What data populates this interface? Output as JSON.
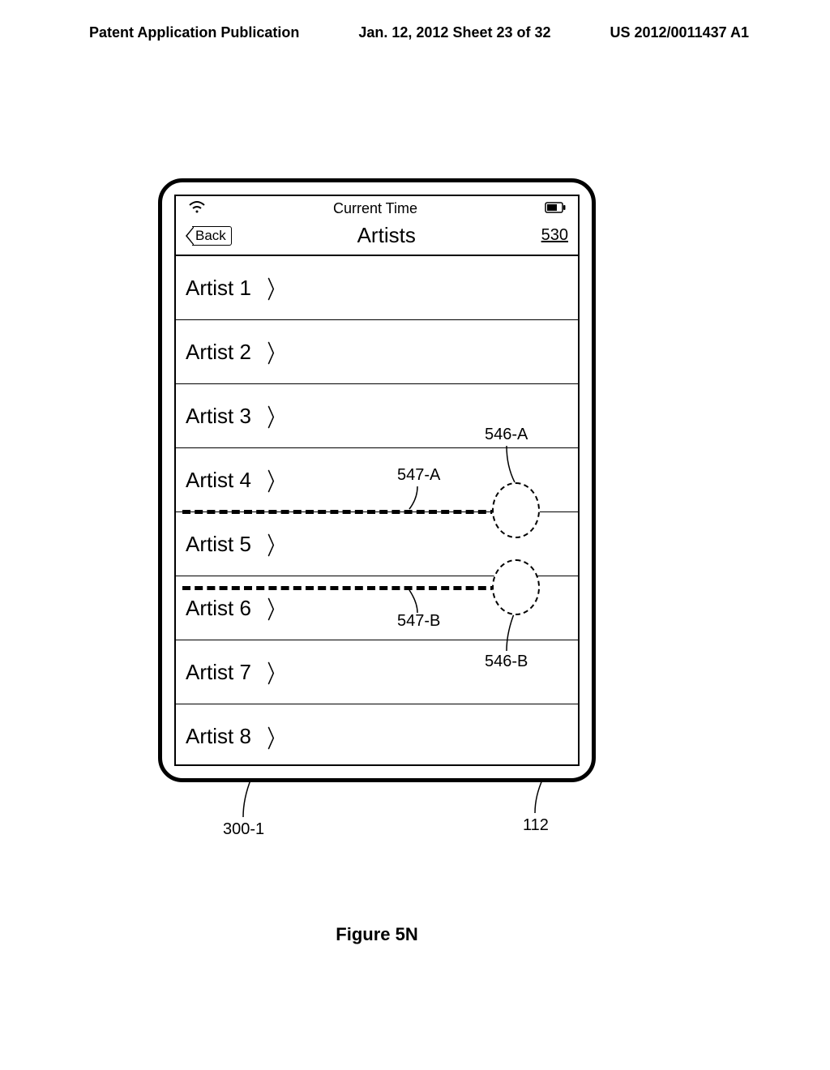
{
  "page_header": {
    "left": "Patent Application Publication",
    "center": "Jan. 12, 2012  Sheet 23 of 32",
    "right": "US 2012/0011437 A1"
  },
  "status_bar": {
    "time_label": "Current Time"
  },
  "nav_bar": {
    "back_label": "Back",
    "title": "Artists",
    "ref_number": "530"
  },
  "artists": [
    {
      "label": "Artist 1"
    },
    {
      "label": "Artist 2"
    },
    {
      "label": "Artist 3"
    },
    {
      "label": "Artist 4"
    },
    {
      "label": "Artist 5"
    },
    {
      "label": "Artist 6"
    },
    {
      "label": "Artist 7"
    },
    {
      "label": "Artist 8"
    }
  ],
  "callouts": {
    "c546a": "546-A",
    "c547a": "547-A",
    "c547b": "547-B",
    "c546b": "546-B",
    "c300_1": "300-1",
    "c112": "112"
  },
  "figure_caption": "Figure 5N"
}
